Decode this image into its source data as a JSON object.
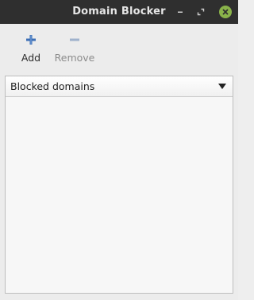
{
  "window": {
    "title": "Domain Blocker"
  },
  "titlebar_controls": {
    "minimize_icon": "minimize-icon",
    "maximize_icon": "maximize-icon",
    "close_icon": "close-icon",
    "close_color": "#8ab34a"
  },
  "toolbar": {
    "add_label": "Add",
    "add_icon": "plus-icon",
    "remove_label": "Remove",
    "remove_icon": "minus-icon",
    "remove_enabled": false,
    "icon_color": "#3d6fb6"
  },
  "list": {
    "column_header": "Blocked domains",
    "sort_icon": "sort-descending-icon",
    "rows": []
  }
}
